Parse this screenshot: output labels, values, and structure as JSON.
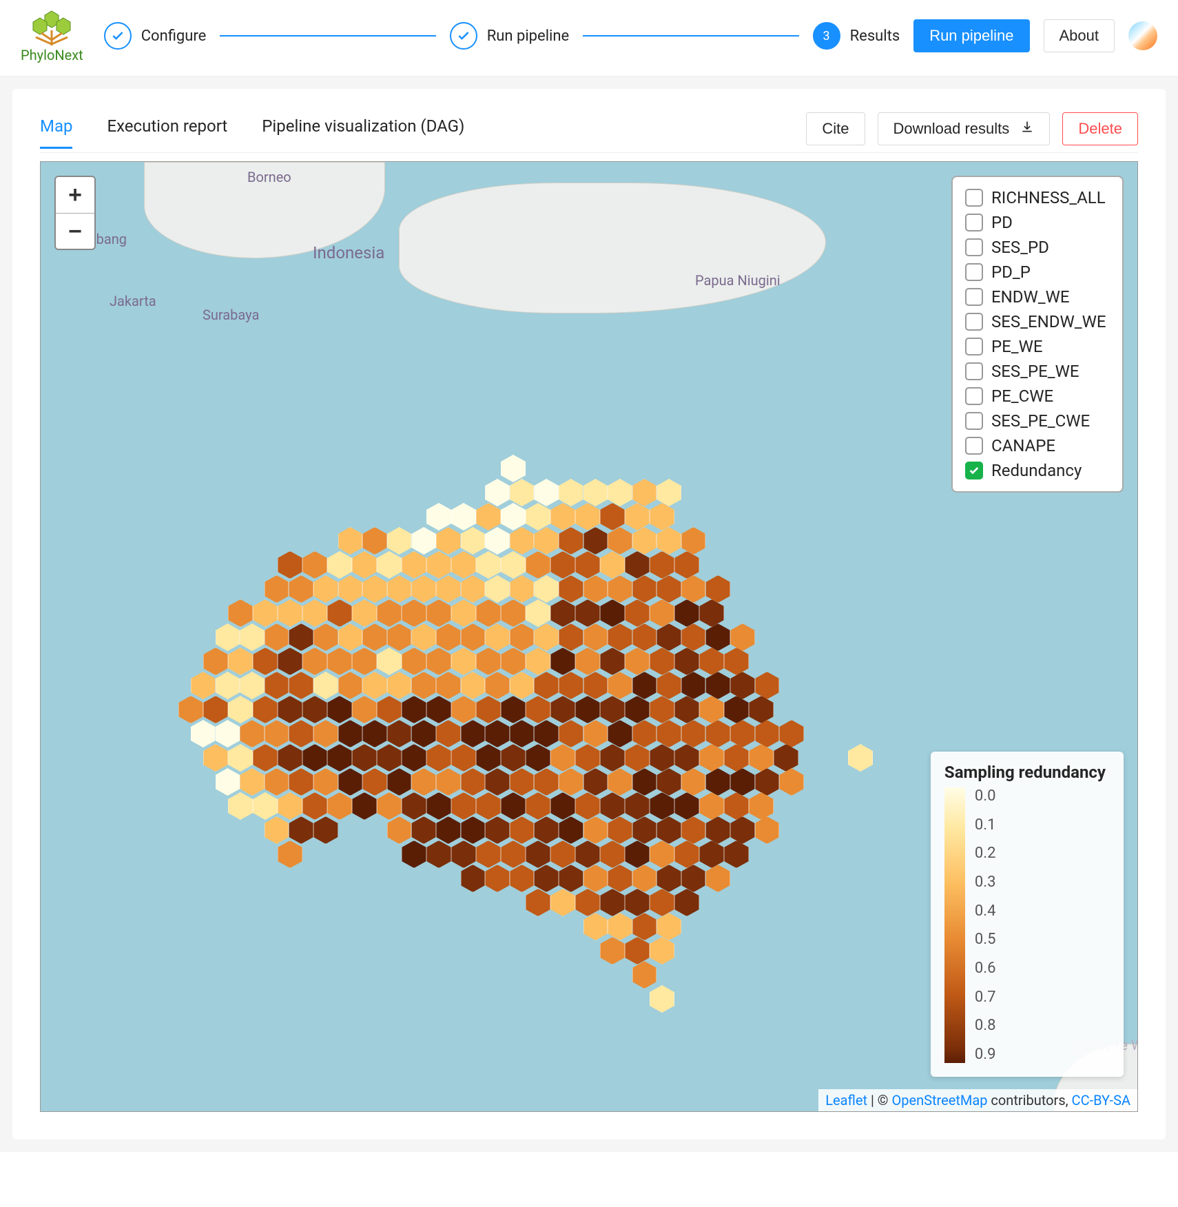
{
  "app": {
    "name": "PhyloNext"
  },
  "steps": [
    {
      "label": "Configure",
      "state": "done"
    },
    {
      "label": "Run pipeline",
      "state": "done"
    },
    {
      "label": "Results",
      "state": "current",
      "number": "3"
    }
  ],
  "header_buttons": {
    "run": "Run pipeline",
    "about": "About"
  },
  "tabs": [
    {
      "id": "map",
      "label": "Map",
      "active": true
    },
    {
      "id": "report",
      "label": "Execution report",
      "active": false
    },
    {
      "id": "dag",
      "label": "Pipeline visualization (DAG)",
      "active": false
    }
  ],
  "result_actions": {
    "cite": "Cite",
    "download": "Download results",
    "delete": "Delete"
  },
  "map": {
    "zoom_in": "+",
    "zoom_out": "−",
    "places": [
      "Borneo",
      "Indonesia",
      "Jakarta",
      "Surabaya",
      "Papua Niugini",
      "Pembang",
      "South Te Waip"
    ],
    "layers": [
      {
        "id": "RICHNESS_ALL",
        "label": "RICHNESS_ALL",
        "checked": false
      },
      {
        "id": "PD",
        "label": "PD",
        "checked": false
      },
      {
        "id": "SES_PD",
        "label": "SES_PD",
        "checked": false
      },
      {
        "id": "PD_P",
        "label": "PD_P",
        "checked": false
      },
      {
        "id": "ENDW_WE",
        "label": "ENDW_WE",
        "checked": false
      },
      {
        "id": "SES_ENDW_WE",
        "label": "SES_ENDW_WE",
        "checked": false
      },
      {
        "id": "PE_WE",
        "label": "PE_WE",
        "checked": false
      },
      {
        "id": "SES_PE_WE",
        "label": "SES_PE_WE",
        "checked": false
      },
      {
        "id": "PE_CWE",
        "label": "PE_CWE",
        "checked": false
      },
      {
        "id": "SES_PE_CWE",
        "label": "SES_PE_CWE",
        "checked": false
      },
      {
        "id": "CANAPE",
        "label": "CANAPE",
        "checked": false
      },
      {
        "id": "Redundancy",
        "label": "Redundancy",
        "checked": true
      }
    ],
    "legend": {
      "title": "Sampling redundancy",
      "ticks": [
        "0.0",
        "0.1",
        "0.2",
        "0.3",
        "0.4",
        "0.5",
        "0.6",
        "0.7",
        "0.8",
        "0.9"
      ]
    },
    "attribution": {
      "leaflet": "Leaflet",
      "mid": " | © ",
      "osm": "OpenStreetMap",
      "tail": " contributors, ",
      "license": "CC-BY-SA"
    },
    "hex_color_ramp": [
      "#fffde6",
      "#ffe8a0",
      "#fdbe60",
      "#e88b33",
      "#c05a16",
      "#7a2e09",
      "#5a1e05"
    ],
    "hex_shape_cols_per_row": [
      0,
      0,
      0,
      0,
      0,
      0,
      0,
      0,
      0,
      0,
      0,
      0,
      0,
      1,
      0,
      0,
      0,
      0,
      0,
      0,
      0,
      0,
      0,
      0,
      0,
      0,
      0,
      0,
      0,
      0,
      0,
      0,
      0,
      0,
      0,
      0,
      0,
      0,
      0,
      0,
      0,
      1,
      1,
      1,
      1,
      1,
      1,
      1,
      1,
      0,
      0,
      0,
      0,
      0,
      0,
      0,
      0,
      0,
      0,
      0,
      0,
      0,
      0,
      0,
      0,
      0,
      0,
      0,
      1,
      1,
      1,
      1,
      1,
      1,
      1,
      1,
      1,
      1,
      0,
      0,
      0,
      0,
      0,
      0,
      0,
      0,
      0,
      0,
      0,
      0,
      0,
      0,
      0,
      1,
      1,
      1,
      1,
      1,
      1,
      1,
      1,
      1,
      1,
      1,
      1,
      1,
      1,
      1,
      0,
      0,
      0,
      0,
      0,
      0,
      0,
      0,
      0,
      0,
      0,
      0,
      1,
      1,
      1,
      1,
      1,
      1,
      1,
      1,
      1,
      1,
      1,
      1,
      1,
      1,
      1,
      1,
      1,
      0,
      0,
      0,
      0,
      0,
      0,
      0,
      0,
      0,
      0,
      0,
      1,
      1,
      1,
      1,
      1,
      1,
      1,
      1,
      1,
      1,
      1,
      1,
      1,
      1,
      1,
      1,
      1,
      1,
      1,
      0,
      0,
      0,
      0,
      0,
      0,
      0,
      0,
      0,
      1,
      1,
      1,
      1,
      1,
      1,
      1,
      1,
      1,
      1,
      1,
      1,
      1,
      1,
      1,
      1,
      1,
      1,
      1,
      1,
      0,
      0,
      0,
      0,
      0,
      0,
      0,
      0,
      1,
      1,
      1,
      1,
      1,
      1,
      1,
      1,
      1,
      1,
      1,
      1,
      1,
      1,
      1,
      1,
      1,
      1,
      1,
      1,
      1,
      1,
      0,
      0,
      0,
      0,
      0,
      0,
      0,
      1,
      1,
      1,
      1,
      1,
      1,
      1,
      1,
      1,
      1,
      1,
      1,
      1,
      1,
      1,
      1,
      1,
      1,
      1,
      1,
      1,
      1,
      0,
      0,
      0,
      0,
      0,
      0,
      1,
      1,
      1,
      1,
      1,
      1,
      1,
      1,
      1,
      1,
      1,
      1,
      1,
      1,
      1,
      1,
      1,
      1,
      1,
      1,
      1,
      1,
      1,
      1,
      0,
      0,
      0,
      0,
      0,
      1,
      1,
      1,
      1,
      1,
      1,
      1,
      1,
      1,
      1,
      1,
      1,
      1,
      1,
      1,
      1,
      1,
      1,
      1,
      1,
      1,
      1,
      1,
      1,
      0,
      0,
      0,
      0,
      0,
      1,
      1,
      1,
      1,
      1,
      1,
      1,
      1,
      1,
      1,
      1,
      1,
      1,
      1,
      1,
      1,
      1,
      1,
      1,
      1,
      1,
      1,
      1,
      1,
      1,
      0,
      0,
      0,
      0,
      0,
      1,
      1,
      1,
      1,
      1,
      1,
      1,
      1,
      1,
      1,
      1,
      1,
      1,
      1,
      1,
      1,
      1,
      1,
      1,
      1,
      1,
      1,
      1,
      1,
      0,
      0,
      1,
      0,
      0,
      1,
      1,
      1,
      1,
      1,
      1,
      1,
      1,
      1,
      1,
      1,
      1,
      1,
      1,
      1,
      1,
      1,
      1,
      1,
      1,
      1,
      1,
      1,
      1,
      0,
      0,
      0,
      0,
      0,
      0,
      1,
      1,
      1,
      1,
      1,
      1,
      1,
      1,
      1,
      1,
      1,
      1,
      1,
      1,
      1,
      1,
      1,
      1,
      1,
      1,
      1,
      1,
      0,
      0,
      0,
      0,
      0,
      0,
      0,
      0,
      1,
      1,
      1,
      0,
      0,
      1,
      1,
      1,
      1,
      1,
      1,
      1,
      1,
      1,
      1,
      1,
      1,
      1,
      1,
      1,
      1,
      0,
      0,
      0,
      0,
      0,
      0,
      0,
      0,
      0,
      1,
      0,
      0,
      0,
      0,
      1,
      1,
      1,
      1,
      1,
      1,
      1,
      1,
      1,
      1,
      1,
      1,
      1,
      1,
      0,
      0,
      0,
      0,
      0,
      0,
      0,
      0,
      0,
      0,
      0,
      0,
      0,
      0,
      0,
      0,
      0,
      1,
      1,
      1,
      1,
      1,
      1,
      1,
      1,
      1,
      1,
      1,
      0,
      0,
      0,
      0,
      0,
      0,
      0,
      0,
      0,
      0,
      0,
      0,
      0,
      0,
      0,
      0,
      0,
      0,
      0,
      0,
      0,
      1,
      1,
      1,
      1,
      1,
      1,
      1,
      0,
      0,
      0,
      0,
      0,
      0,
      0,
      0,
      0,
      0,
      0,
      0,
      0,
      0,
      0,
      0,
      0,
      0,
      0,
      0,
      0,
      0,
      0,
      0,
      1,
      1,
      1,
      1,
      0,
      0,
      0,
      0,
      0,
      0,
      0,
      0,
      0,
      0,
      0,
      0,
      0,
      0,
      0,
      0,
      0,
      0,
      0,
      0,
      0,
      0,
      0,
      0,
      0,
      0,
      1,
      1,
      1,
      0,
      0,
      0,
      0,
      0,
      0,
      0,
      0,
      0,
      0,
      0,
      0,
      0,
      0,
      0,
      0,
      0,
      0,
      0,
      0,
      0,
      0,
      0,
      0,
      0,
      0,
      0,
      1,
      0,
      0,
      0,
      0,
      0,
      0,
      0,
      0,
      0,
      0,
      0,
      0,
      0,
      0,
      0,
      0,
      0,
      0,
      0,
      0,
      0,
      0,
      0,
      0,
      0,
      0,
      0,
      0,
      0,
      1,
      0,
      0,
      0,
      0,
      0,
      0,
      0,
      0,
      0
    ],
    "hex_cols": 29
  }
}
